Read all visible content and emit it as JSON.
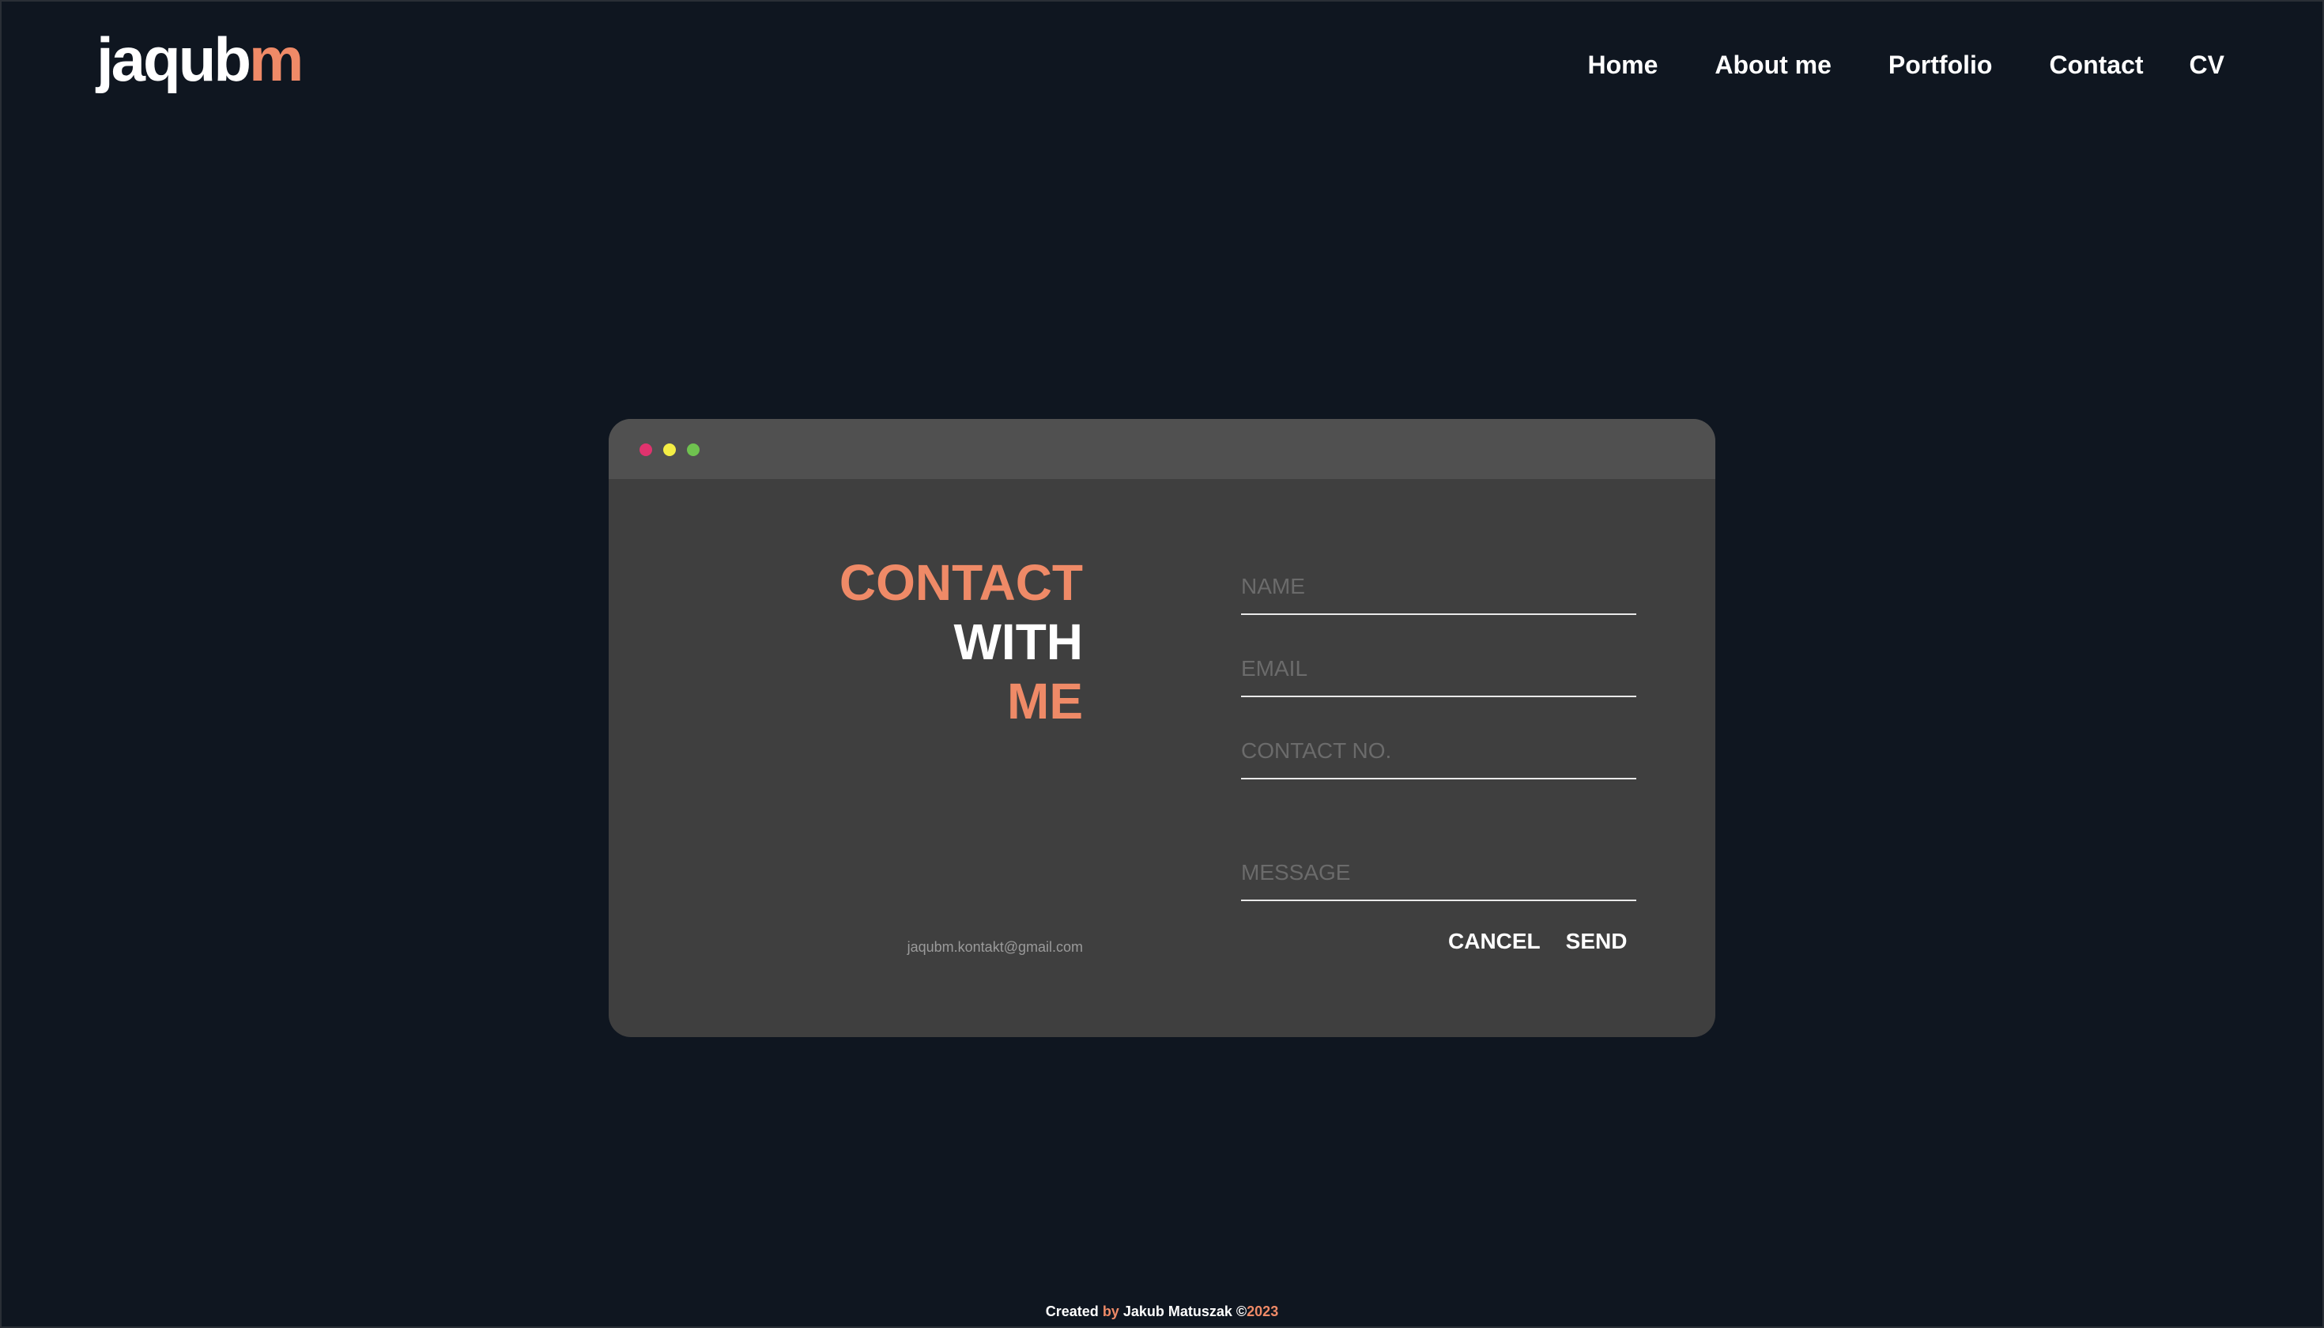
{
  "header": {
    "logo_main": "jaqub",
    "logo_accent": "m",
    "nav": [
      "Home",
      "About me",
      "Portfolio",
      "Contact",
      "CV"
    ]
  },
  "contact": {
    "heading_line1": "CONTACT",
    "heading_line2": "WITH",
    "heading_line3": "ME",
    "email": "jaqubm.kontakt@gmail.com",
    "fields": {
      "name_placeholder": "NAME",
      "email_placeholder": "EMAIL",
      "phone_placeholder": "CONTACT NO.",
      "message_placeholder": "MESSAGE"
    },
    "cancel_label": "CANCEL",
    "send_label": "SEND"
  },
  "footer": {
    "created": "Created ",
    "by": "by",
    "author": " Jakub Matuszak ©",
    "year": "2023"
  },
  "colors": {
    "background": "#0f1620",
    "accent": "#ef8a67",
    "window": "#3f3f3f",
    "titlebar": "#505050",
    "dot_red": "#e0336e",
    "dot_yellow": "#f4ee45",
    "dot_green": "#6fc24f"
  }
}
